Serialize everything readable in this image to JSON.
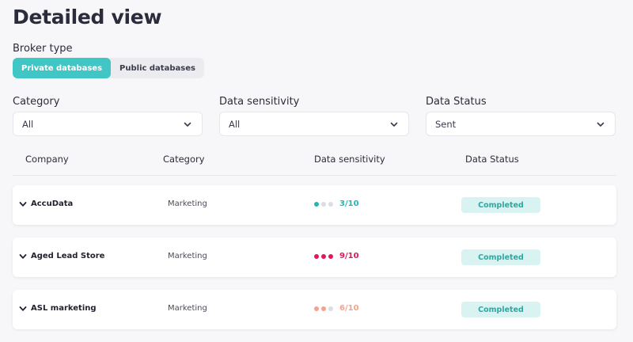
{
  "page": {
    "title": "Detailed view"
  },
  "broker": {
    "label": "Broker type",
    "options": [
      "Private databases",
      "Public databases"
    ],
    "selected": "Private databases"
  },
  "filters": {
    "category": {
      "label": "Category",
      "value": "All"
    },
    "sensitivity": {
      "label": "Data sensitivity",
      "value": "All"
    },
    "status": {
      "label": "Data Status",
      "value": "Sent"
    }
  },
  "table": {
    "columns": [
      "Company",
      "Category",
      "Data sensitivity",
      "Data Status"
    ],
    "rows": [
      {
        "company": "AccuData",
        "category": "Marketing",
        "sensitivity": "3/10",
        "level": 1,
        "status": "Completed"
      },
      {
        "company": "Aged Lead Store",
        "category": "Marketing",
        "sensitivity": "9/10",
        "level": 3,
        "status": "Completed"
      },
      {
        "company": "ASL marketing",
        "category": "Marketing",
        "sensitivity": "6/10",
        "level": 2,
        "status": "Completed"
      }
    ]
  },
  "colors": {
    "accent": "#41c6c6",
    "low": "#26b5b0",
    "high": "#e0185a",
    "medium": "#f4a38b",
    "dot_inactive": "#dcdde6",
    "completed_bg": "#d8f3f1",
    "completed_text": "#2aa9a3"
  },
  "icons": {
    "select": "chevron-down-icon",
    "row_expand": "chevron-down-icon"
  }
}
